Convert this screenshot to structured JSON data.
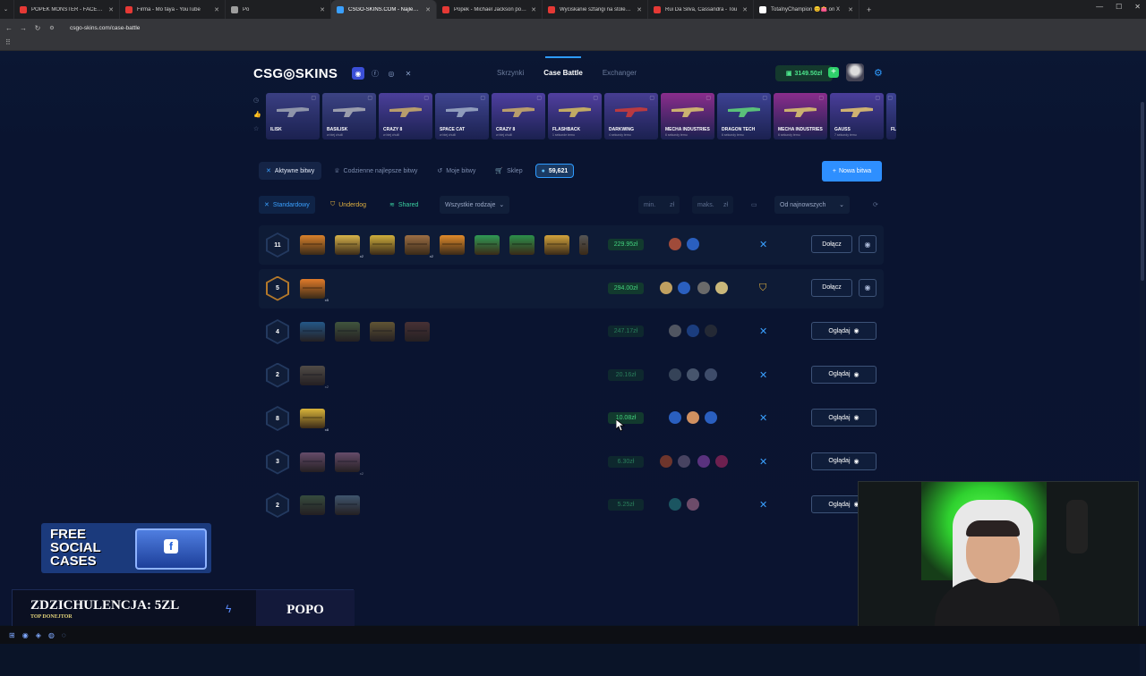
{
  "browser": {
    "tabs": [
      {
        "title": "POPEK MONSTER - FACEBURG",
        "color": "#e53935"
      },
      {
        "title": "Firma - Mo faya - YouTube",
        "color": "#e53935"
      },
      {
        "title": "Po",
        "color": "#9e9e9e"
      },
      {
        "title": "CSGO-SKINS.COM - Najlepsze",
        "color": "#3aa0ff",
        "active": true
      },
      {
        "title": "Popek - Michael Jackson po od",
        "color": "#e53935"
      },
      {
        "title": "Wyciskanie sztangi na stole 1 ti",
        "color": "#e53935"
      },
      {
        "title": "Rui Da Silva, Cassandra - Tou",
        "color": "#e53935"
      },
      {
        "title": "TotalnyChampion 😊👛 on X",
        "color": "#ffffff"
      }
    ],
    "url": "csgo-skins.com/case-battle"
  },
  "site": {
    "logo": "CSG◎SKINS",
    "nav": {
      "cases": "Skrzynki",
      "battle": "Case Battle",
      "exchanger": "Exchanger"
    },
    "balance": "3149.50zł",
    "ticker": [
      {
        "name": "ILISK",
        "sub": "",
        "bg": "#3a3f82",
        "gun": "#9aa0b0"
      },
      {
        "name": "BASILISK",
        "sub": "w biej chuili",
        "bg": "#3c4384",
        "gun": "#a6a8b4"
      },
      {
        "name": "CRAZY 8",
        "sub": "w biej chuili",
        "bg": "#4b3f9a",
        "gun": "#c7a86a"
      },
      {
        "name": "SPACE CAT",
        "sub": "w biej chuili",
        "bg": "#3f4590",
        "gun": "#9aa7c3"
      },
      {
        "name": "CRAZY 8",
        "sub": "w biej chuili",
        "bg": "#4e3fa0",
        "gun": "#c7a86a"
      },
      {
        "name": "FLASHBACK",
        "sub": "1 sekunde temu",
        "bg": "#513f9f",
        "gun": "#d0b860"
      },
      {
        "name": "DARKWING",
        "sub": "4 sekundy temu",
        "bg": "#463d92",
        "gun": "#c83b3b"
      },
      {
        "name": "MECHA INDUSTRIES",
        "sub": "6 sekundy temu",
        "bg": "#8a2d8c",
        "gun": "#d8c070"
      },
      {
        "name": "DRAGON TECH",
        "sub": "6 sekundy temu",
        "bg": "#3d4293",
        "gun": "#5fd07a"
      },
      {
        "name": "MECHA INDUSTRIES",
        "sub": "6 sekundy temu",
        "bg": "#8a2d8c",
        "gun": "#d8c070"
      },
      {
        "name": "GAUSS",
        "sub": "7 sekundy temu",
        "bg": "#4a3e9a",
        "gun": "#e0c070"
      },
      {
        "name": "FLA",
        "sub": "",
        "bg": "#3d4293",
        "gun": "#aaa"
      }
    ],
    "tabs": {
      "active": "Aktywne bitwy",
      "best": "Codzienne najlepsze bitwy",
      "mine": "Moje bitwy",
      "shop": "Sklep",
      "coins": "59,621"
    },
    "new_battle": "Nowa bitwa",
    "filters": {
      "standard": "Standardowy",
      "underdog": "Underdog",
      "shared": "Shared",
      "kinds": "Wszystkie rodzaje",
      "min": "min.",
      "max": "maks.",
      "currency": "zł",
      "sort": "Od najnowszych"
    },
    "battles": [
      {
        "rounds": "11",
        "price": "229.95zł",
        "action": "Dołącz",
        "mode": "standard",
        "dim": false,
        "cases": [
          {
            "c": "#d9812b"
          },
          {
            "c": "#d7b34a",
            "n": "x2"
          },
          {
            "c": "#cfae3c"
          },
          {
            "c": "#9c6e44",
            "n": "x2"
          },
          {
            "c": "#e08a2a"
          },
          {
            "c": "#2f9a54"
          },
          {
            "c": "#2b8f4a"
          },
          {
            "c": "#d2a33c"
          },
          {
            "c": "#555"
          }
        ],
        "players": [
          {
            "c": "#a04b3a"
          },
          {
            "c": "#2a5fbf"
          }
        ]
      },
      {
        "rounds": "5",
        "price": "294.00zł",
        "action": "Dołącz",
        "mode": "underdog",
        "dim": false,
        "cases": [
          {
            "c": "#e07b2a",
            "n": "x5"
          }
        ],
        "players": [
          {
            "c": "#c0a060"
          },
          {
            "c": "#2a5fbf"
          },
          {
            "c": "#6a6a6a"
          },
          {
            "c": "#c9b77a"
          }
        ]
      },
      {
        "rounds": "4",
        "price": "247.17zł",
        "action": "Oglądaj",
        "mode": "standard",
        "dim": true,
        "cases": [
          {
            "c": "#3a8fd0"
          },
          {
            "c": "#6e8b4a"
          },
          {
            "c": "#a88a3a"
          },
          {
            "c": "#7a4a3a"
          }
        ],
        "players": [
          {
            "c": "#8a8a8a"
          },
          {
            "c": "#2a5fbf"
          },
          {
            "c": "#3a3a3a"
          }
        ]
      },
      {
        "rounds": "2",
        "price": "20.16zł",
        "action": "Oglądaj",
        "mode": "standard",
        "dim": true,
        "cases": [
          {
            "c": "#8a7a5a",
            "n": "x2"
          }
        ],
        "players": [
          {
            "c": "#5a6a7a"
          },
          {
            "c": "#7a8aa0"
          },
          {
            "c": "#6a7a9a"
          }
        ]
      },
      {
        "rounds": "8",
        "price": "10.08zł",
        "action": "Oglądaj",
        "mode": "standard",
        "dim": false,
        "cases": [
          {
            "c": "#d9b43a",
            "n": "x8"
          }
        ],
        "players": [
          {
            "c": "#2a5fbf"
          },
          {
            "c": "#d09060"
          },
          {
            "c": "#2a5fbf"
          }
        ]
      },
      {
        "rounds": "3",
        "price": "6.30zł",
        "action": "Oglądaj",
        "mode": "standard",
        "dim": true,
        "cases": [
          {
            "c": "#b07a9a"
          },
          {
            "c": "#b07a9a",
            "n": "x2"
          }
        ],
        "players": [
          {
            "c": "#c0502a"
          },
          {
            "c": "#7a6a8a"
          },
          {
            "c": "#9a4ac0"
          },
          {
            "c": "#c02a6a"
          }
        ]
      },
      {
        "rounds": "2",
        "price": "5.25zł",
        "action": "Oglądaj",
        "mode": "standard",
        "dim": true,
        "cases": [
          {
            "c": "#5a7a4a"
          },
          {
            "c": "#6a8aa0"
          }
        ],
        "players": [
          {
            "c": "#2a8a8a"
          },
          {
            "c": "#c07a9a"
          }
        ]
      }
    ]
  },
  "overlay": {
    "promo": "FREE SOCIAL CASES",
    "promo_fb": "f",
    "donor_title": "ZDZICHULENCJA: 5ZL",
    "donor_sub": "TOP DONEJTOR",
    "donor_name": "POPO"
  },
  "colors": {
    "accent": "#2e8fff",
    "price_green": "#42d17e"
  }
}
